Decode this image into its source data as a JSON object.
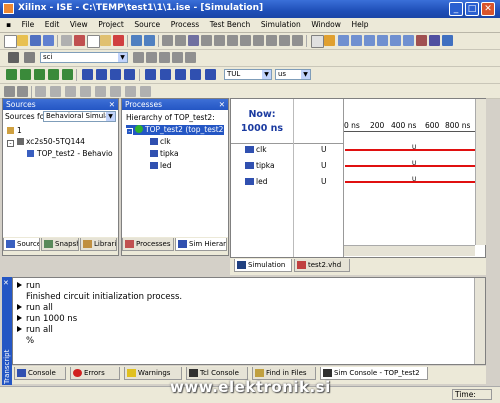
{
  "window": {
    "title": "Xilinx - ISE - C:\\TEMP\\test1\\1\\1.ise - [Simulation]",
    "min": "_",
    "max": "□",
    "close": "✕"
  },
  "menu": [
    "File",
    "Edit",
    "View",
    "Project",
    "Source",
    "Process",
    "Test Bench",
    "Simulation",
    "Window",
    "Help"
  ],
  "toolbar": {
    "search_value": "sci",
    "unit_combo": "TUL",
    "unit2_combo": "us"
  },
  "sources": {
    "header": "Sources",
    "close": "✕",
    "sources_for_label": "Sources for:",
    "sources_for_value": "Behavioral Simula",
    "tree": [
      "1",
      "xc2s50-5TQ144",
      "TOP_test2 - Behavio"
    ],
    "tabs": [
      "Sources",
      "Snapshots",
      "Libraries"
    ]
  },
  "processes": {
    "header": "Processes",
    "close": "✕",
    "hierarchy_label": "Hierarchy of TOP_test2:",
    "tree": [
      "TOP_test2 (top_test2)",
      "clk",
      "tipka",
      "led"
    ],
    "tabs": [
      "Processes",
      "Sim Hierarchy"
    ]
  },
  "wave": {
    "now_label": "Now:",
    "now_value": "1000 ns",
    "ticks": [
      "0 ns",
      "200",
      "400 ns",
      "600",
      "800 ns"
    ],
    "signals": [
      {
        "name": "clk",
        "value": "U",
        "marker": "U"
      },
      {
        "name": "tipka",
        "value": "U",
        "marker": "U"
      },
      {
        "name": "led",
        "value": "U",
        "marker": "U"
      }
    ],
    "tabs": [
      "Simulation",
      "test2.vhd"
    ]
  },
  "console": {
    "side_label": "Transcript",
    "lines": [
      {
        "bullet": true,
        "text": "run"
      },
      {
        "bullet": false,
        "text": "Finished circuit initialization process."
      },
      {
        "bullet": true,
        "text": "run all"
      },
      {
        "bullet": true,
        "text": "run 1000 ns"
      },
      {
        "bullet": true,
        "text": "run all"
      },
      {
        "bullet": false,
        "text": "%"
      }
    ],
    "tabs": [
      "Console",
      "Errors",
      "Warnings",
      "Tcl Console",
      "Find in Files",
      "Sim Console - TOP_test2"
    ]
  },
  "status": {
    "right": "Time:"
  },
  "watermark": "www.elektronik.si",
  "colors": {
    "title": "#2456c4",
    "signal": "#e01010"
  }
}
